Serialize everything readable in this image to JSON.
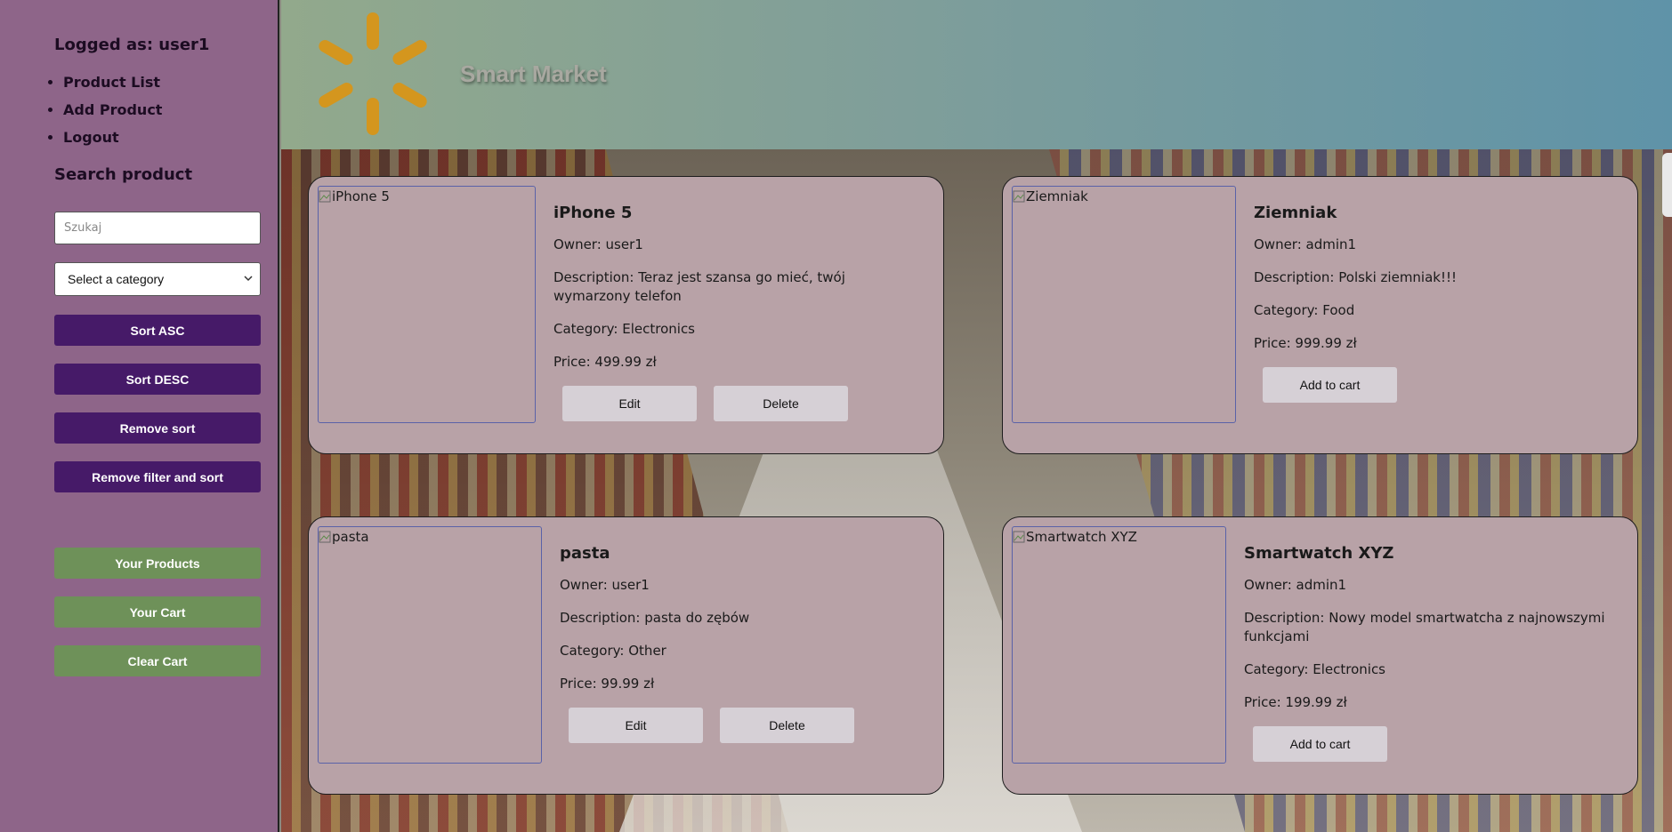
{
  "sidebar": {
    "logged_as": "Logged as: user1",
    "nav": [
      "Product List",
      "Add Product",
      "Logout"
    ],
    "search_title": "Search product",
    "search_placeholder": "Szukaj",
    "category_selected": "Select a category",
    "buttons": {
      "sort_asc": "Sort ASC",
      "sort_desc": "Sort DESC",
      "remove_sort": "Remove sort",
      "remove_filter_sort": "Remove filter and sort",
      "your_products": "Your Products",
      "your_cart": "Your Cart",
      "clear_cart": "Clear Cart"
    }
  },
  "header": {
    "brand": "Smart Market",
    "logo_color": "#d4961e"
  },
  "products": [
    {
      "alt": "iPhone 5",
      "name": "iPhone 5",
      "owner": "Owner: user1",
      "description": "Description: Teraz jest szansa go mieć, twój wymarzony telefon",
      "category": "Category: Electronics",
      "price": "Price: 499.99 zł",
      "actions": [
        "Edit",
        "Delete"
      ]
    },
    {
      "alt": "Ziemniak",
      "name": "Ziemniak",
      "owner": "Owner: admin1",
      "description": "Description: Polski ziemniak!!!",
      "category": "Category: Food",
      "price": "Price: 999.99 zł",
      "actions": [
        "Add to cart"
      ]
    },
    {
      "alt": "pasta",
      "name": "pasta",
      "owner": "Owner: user1",
      "description": "Description: pasta do zębów",
      "category": "Category: Other",
      "price": "Price: 99.99 zł",
      "actions": [
        "Edit",
        "Delete"
      ]
    },
    {
      "alt": "Smartwatch XYZ",
      "name": "Smartwatch XYZ",
      "owner": "Owner: admin1",
      "description": "Description: Nowy model smartwatcha z najnowszymi funkcjami",
      "category": "Category: Electronics",
      "price": "Price: 199.99 zł",
      "actions": [
        "Add to cart"
      ]
    }
  ]
}
